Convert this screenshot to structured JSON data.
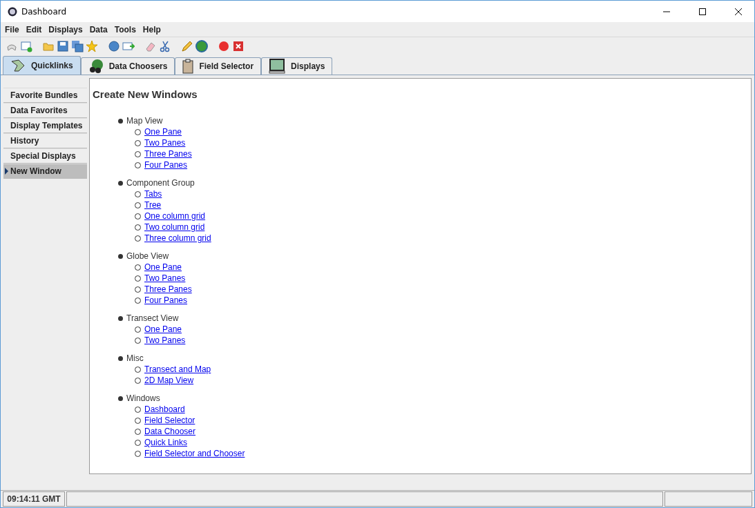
{
  "window": {
    "title": "Dashboard"
  },
  "menu": [
    "File",
    "Edit",
    "Displays",
    "Data",
    "Tools",
    "Help"
  ],
  "tabs": [
    {
      "label": "Quicklinks",
      "selected": true,
      "kind": "quicklinks"
    },
    {
      "label": "Data Choosers",
      "selected": false,
      "kind": "choosers"
    },
    {
      "label": "Field Selector",
      "selected": false,
      "kind": "field"
    },
    {
      "label": "Displays",
      "selected": false,
      "kind": "displays"
    }
  ],
  "sidebar": {
    "items": [
      {
        "label": "Favorite Bundles",
        "selected": false
      },
      {
        "label": "Data Favorites",
        "selected": false
      },
      {
        "label": "Display Templates",
        "selected": false
      },
      {
        "label": "History",
        "selected": false
      },
      {
        "label": "Special Displays",
        "selected": false
      },
      {
        "label": "New Window",
        "selected": true
      }
    ]
  },
  "content": {
    "heading": "Create New Windows",
    "groups": [
      {
        "title": "Map View",
        "links": [
          "One Pane",
          "Two Panes",
          "Three Panes",
          "Four Panes"
        ]
      },
      {
        "title": "Component Group",
        "links": [
          "Tabs",
          "Tree",
          "One column grid",
          "Two column grid",
          "Three column grid"
        ]
      },
      {
        "title": "Globe View",
        "links": [
          "One Pane",
          "Two Panes",
          "Three Panes",
          "Four Panes"
        ]
      },
      {
        "title": "Transect View",
        "links": [
          "One Pane",
          "Two Panes"
        ]
      },
      {
        "title": "Misc",
        "links": [
          "Transect and Map",
          "2D Map View"
        ]
      },
      {
        "title": "Windows",
        "links": [
          "Dashboard",
          "Field Selector",
          "Data Chooser",
          "Quick Links",
          "Field Selector and Chooser"
        ]
      }
    ]
  },
  "status_bar": {
    "time": "09:14:11 GMT"
  }
}
